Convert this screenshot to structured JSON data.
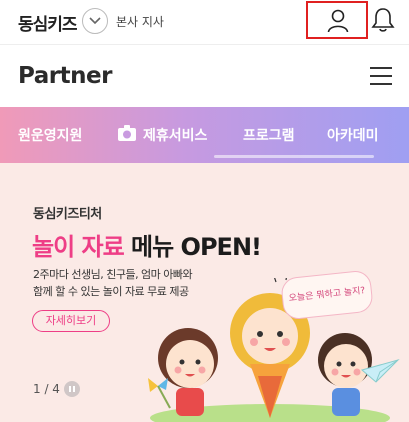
{
  "header": {
    "brand": "동심키즈",
    "branch": "본사 지사",
    "icons": [
      "chevron-down-icon",
      "user-icon",
      "bell-icon"
    ]
  },
  "bar2": {
    "logo": "Partner",
    "menu_icon": "hamburger-menu-icon"
  },
  "nav": {
    "items": [
      {
        "label": "원운영지원"
      },
      {
        "label": "제휴서비스"
      },
      {
        "label": "프로그램"
      },
      {
        "label": "아카데미"
      }
    ]
  },
  "banner": {
    "brand": "동심키즈티처",
    "title_pink": "놀이 자료",
    "title_dark": " 메뉴 OPEN!",
    "desc_line1": "2주마다 선생님, 친구들, 엄마 아빠와",
    "desc_line2": "함께 할 수 있는 놀이 자료 무료 제공",
    "button": "자세히보기",
    "bubble": "오늘은 뭐하고 놀지?",
    "pager": "1 / 4"
  },
  "colors": {
    "pink": "#ee3e86",
    "highlight": "#e02020",
    "nav_gradient_start": "#f09ab8",
    "nav_gradient_end": "#9f9ff2",
    "banner_bg": "#fbeae6"
  }
}
